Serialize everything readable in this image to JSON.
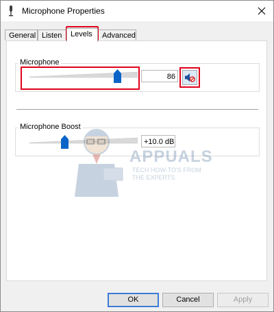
{
  "window": {
    "title": "Microphone Properties"
  },
  "tabs": [
    {
      "label": "General"
    },
    {
      "label": "Listen"
    },
    {
      "label": "Levels",
      "active": true
    },
    {
      "label": "Advanced"
    }
  ],
  "levels": {
    "microphone": {
      "label": "Microphone",
      "value": "86",
      "level_fraction": 0.86,
      "muted": true
    },
    "boost": {
      "label": "Microphone Boost",
      "value": "+10.0 dB",
      "level_fraction": 0.33
    }
  },
  "watermark": {
    "title": "APPUALS",
    "subtitle": "TECH HOW-TO'S FROM THE EXPERTS"
  },
  "buttons": {
    "ok": "OK",
    "cancel": "Cancel",
    "apply": "Apply"
  },
  "colors": {
    "highlight": "#e0001a",
    "thumb": "#0a64c8",
    "accent": "#3a7bd5"
  },
  "icons": {
    "title": "microphone-icon",
    "close": "close-icon",
    "mute": "speaker-muted-icon"
  }
}
